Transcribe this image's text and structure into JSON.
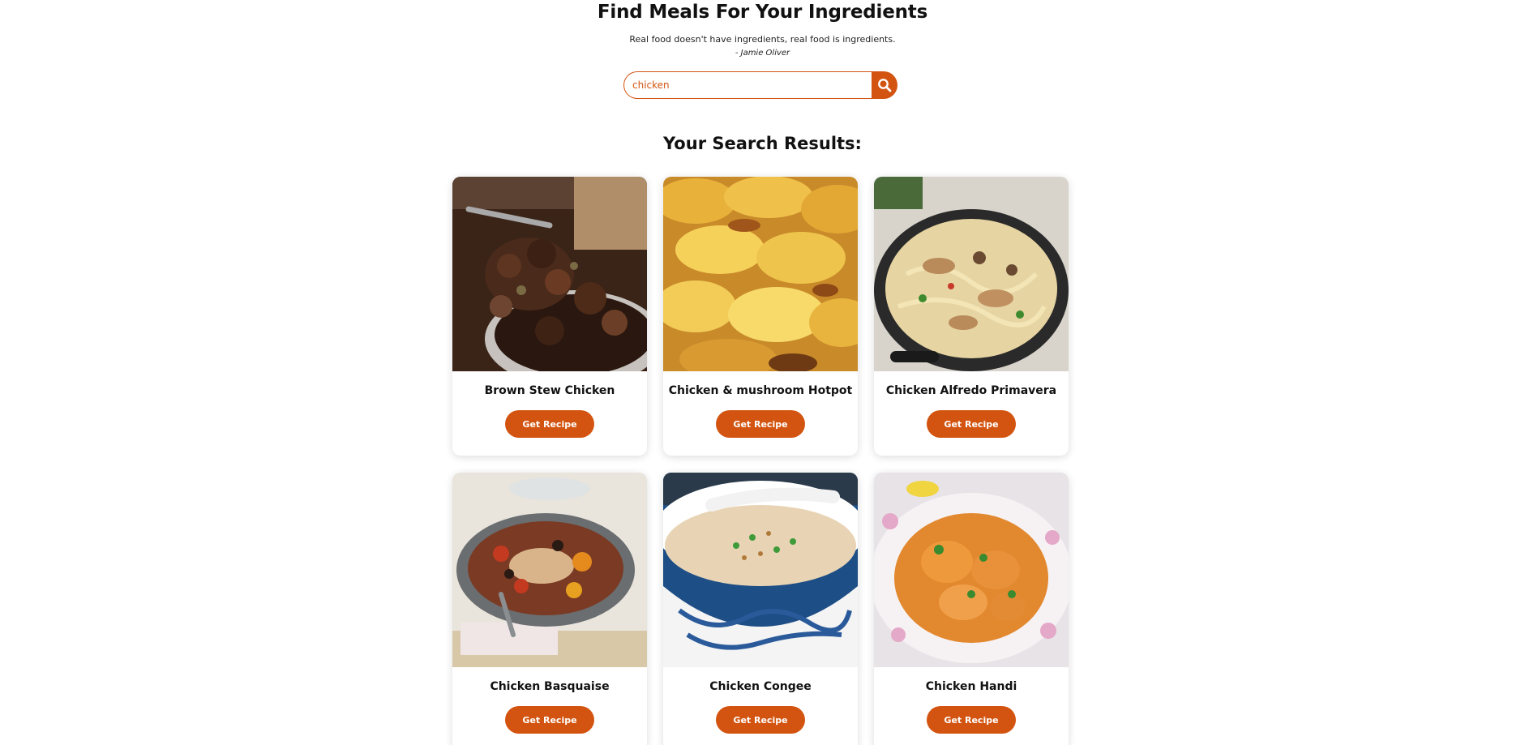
{
  "hero": {
    "title": "Find Meals For Your Ingredients",
    "quote": "Real food doesn't have ingredients, real food is ingredients.",
    "author": "- Jamie Oliver"
  },
  "search": {
    "value": "chicken",
    "button_icon": "search-icon"
  },
  "results": {
    "title": "Your Search Results:",
    "button_label": "Get Recipe",
    "meals": [
      {
        "name": "Brown Stew Chicken",
        "image": "stew-dish-image"
      },
      {
        "name": "Chicken & mushroom Hotpot",
        "image": "hotpot-dish-image"
      },
      {
        "name": "Chicken Alfredo Primavera",
        "image": "pasta-pan-image"
      },
      {
        "name": "Chicken Basquaise",
        "image": "casserole-dish-image"
      },
      {
        "name": "Chicken Congee",
        "image": "congee-bowl-image"
      },
      {
        "name": "Chicken Handi",
        "image": "curry-plate-image"
      }
    ]
  },
  "colors": {
    "accent": "#d35410",
    "text": "#111111",
    "background": "#ffffff"
  }
}
